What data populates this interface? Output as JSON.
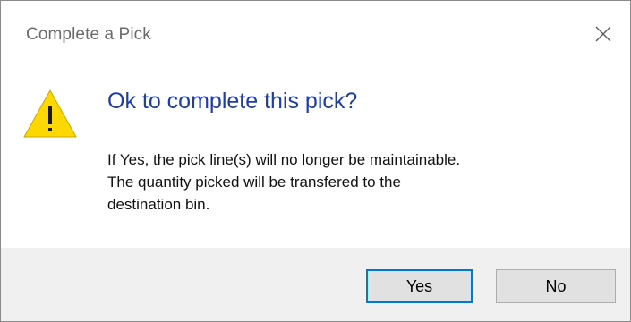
{
  "window": {
    "title": "Complete a Pick",
    "close_icon": "close-icon"
  },
  "content": {
    "icon": "warning-icon",
    "main_instruction": "Ok to complete this pick?",
    "message_lines": [
      "If Yes, the pick line(s) will no longer be maintainable.",
      "The quantity picked will be transfered to the",
      "destination bin."
    ]
  },
  "buttons": {
    "yes_label": "Yes",
    "no_label": "No"
  },
  "colors": {
    "instruction_text": "#1e3da8",
    "focus_border": "#0078d7",
    "warning_fill": "#fdd700",
    "footer_bg": "#f0f0f0"
  }
}
